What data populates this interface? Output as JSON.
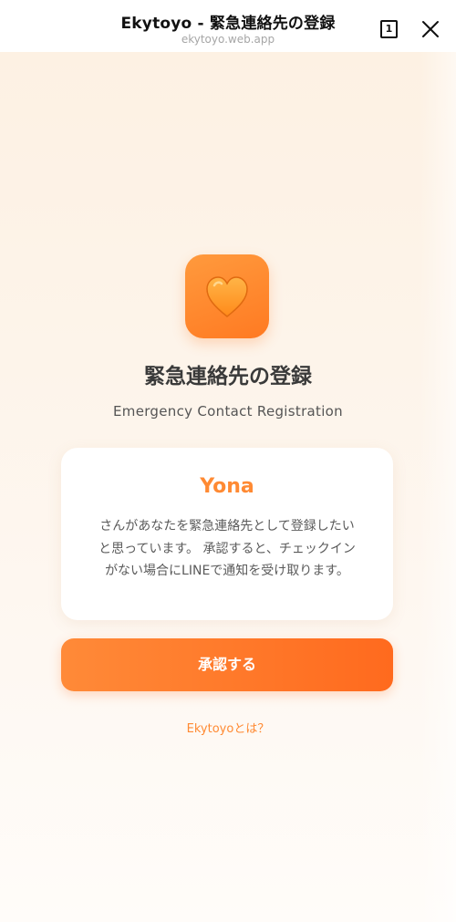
{
  "topbar": {
    "title": "Ekytoyo - 緊急連絡先の登録",
    "url": "ekytoyo.web.app",
    "tab_count": "1",
    "close_icon": "close-icon"
  },
  "app_icon": {
    "icon": "heart-icon",
    "color": "#ff8a2a"
  },
  "main": {
    "title": "緊急連絡先の登録",
    "subtitle": "Emergency Contact Registration"
  },
  "card": {
    "name": "Yona",
    "message_lines": [
      "さんがあなたを緊急連絡先として登録したい",
      "と思っています。 承認すると、チェックイン",
      "がない場合にLINEで通知を受け取ります。"
    ]
  },
  "actions": {
    "approve_label": "承認する",
    "about_link": "Ekytoyoとは？"
  },
  "colors": {
    "accent": "#ff8a33",
    "button_start": "#ff8a38",
    "button_end": "#ff6a1e",
    "background": "#fdf3e8"
  }
}
